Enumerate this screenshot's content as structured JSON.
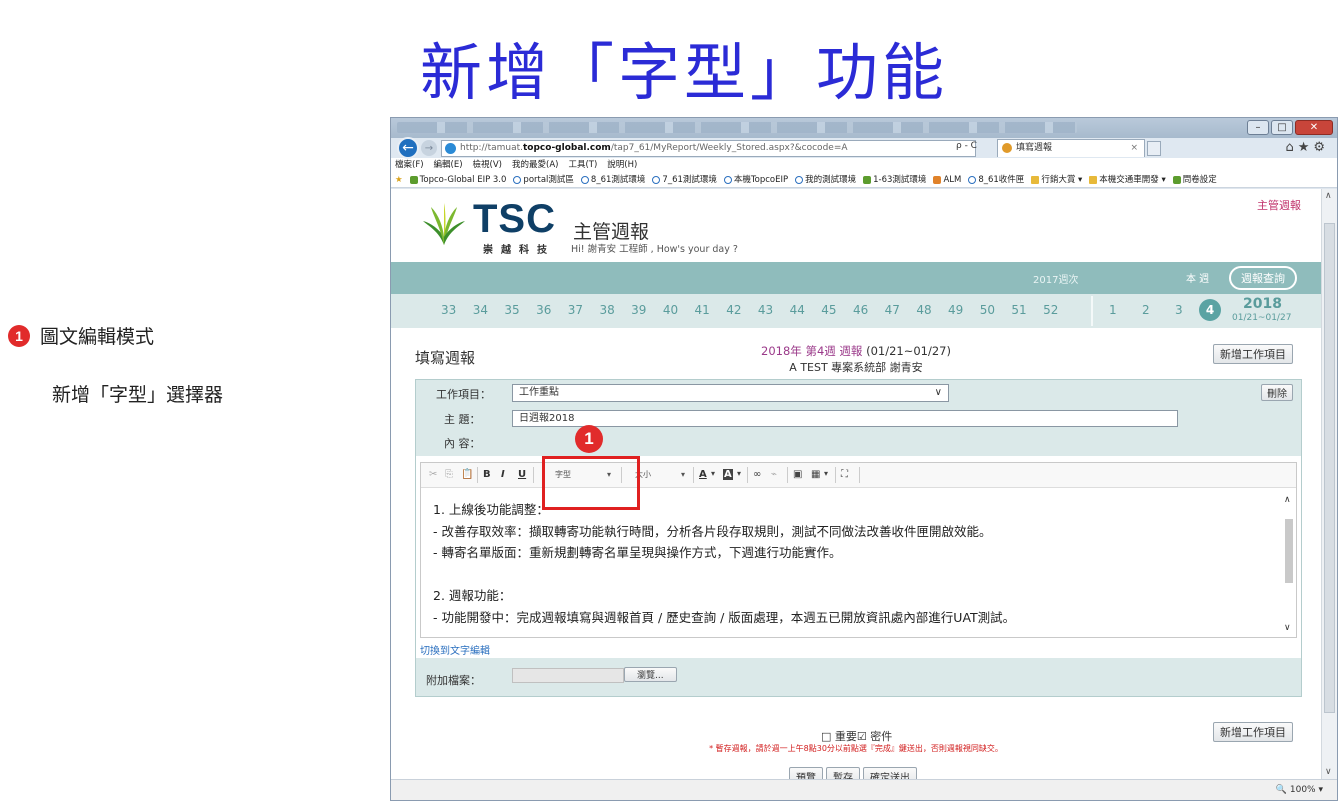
{
  "slide": {
    "title": "新增「字型」功能",
    "callout_number": "1",
    "callout_title": "圖文編輯模式",
    "callout_desc": "新增「字型」選擇器"
  },
  "browser": {
    "url_prefix": "http://tamuat.",
    "url_bold": "topco-global.com",
    "url_suffix": "/tap7_61/MyReport/Weekly_Stored.aspx?&cocode=A",
    "url_tools": "ρ - C",
    "tab_title": "填寫週報",
    "tab_close": "×",
    "menu": [
      "檔案(F)",
      "編輯(E)",
      "檢視(V)",
      "我的最愛(A)",
      "工具(T)",
      "說明(H)"
    ],
    "favorites": [
      {
        "label": "Topco-Global EIP 3.0",
        "icon": "leaf"
      },
      {
        "label": "portal測試區",
        "icon": "ie"
      },
      {
        "label": "8_61測試環境",
        "icon": "ie"
      },
      {
        "label": "7_61測試環境",
        "icon": "ie"
      },
      {
        "label": "本機TopcoEIP",
        "icon": "ie"
      },
      {
        "label": "我的測試環境",
        "icon": "ie"
      },
      {
        "label": "1-63測試環境",
        "icon": "leaf"
      },
      {
        "label": "ALM",
        "icon": "alm"
      },
      {
        "label": "8_61收件匣",
        "icon": "ie"
      },
      {
        "label": "行銷大賞 ▾",
        "icon": "folder"
      },
      {
        "label": "本機交通車開發 ▾",
        "icon": "folder"
      },
      {
        "label": "問卷設定",
        "icon": "leaf"
      }
    ],
    "zoom": "🔍 100%  ▾"
  },
  "app": {
    "logo_text": "TSC",
    "logo_sub": "崇越科技",
    "system_title": "主管週報",
    "greeting": "Hi! 謝青安 工程師 , How's your day ?",
    "top_link": "主管週報",
    "year_label": "2017週次",
    "current_week_label": "本 週",
    "query_button": "週報查詢",
    "weeks_2017": [
      "33",
      "34",
      "35",
      "36",
      "37",
      "38",
      "39",
      "40",
      "41",
      "42",
      "43",
      "44",
      "45",
      "46",
      "47",
      "48",
      "49",
      "50",
      "51",
      "52"
    ],
    "weeks_2018": [
      "1",
      "2",
      "3"
    ],
    "current_week": "4",
    "current_year": "2018",
    "current_range": "01/21~01/27"
  },
  "form": {
    "title": "填寫週報",
    "report_head": "2018年 第4週 週報",
    "report_range": " (01/21~01/27)",
    "report_author": "A TEST 專案系統部 謝青安",
    "add_item_button": "新增工作項目",
    "item_label": "工作項目：",
    "item_value": "工作重點",
    "delete_button": "刪除",
    "subject_label": "主 題：",
    "subject_value": "日週報2018",
    "content_label": "內 容：",
    "toolbar": {
      "cut": "✂",
      "copy": "⎘",
      "paste": "📋",
      "bold": "B",
      "italic": "I",
      "underline": "U",
      "font_combo": "字型",
      "size_combo": "大小",
      "text_color": "A",
      "bg_color": "A",
      "link": "∞",
      "unlink": "⌁",
      "image": "▣",
      "table": "▦",
      "maximize": "⛶"
    },
    "content_lines": [
      "1. 上線後功能調整：",
      " - 改善存取效率：擷取轉寄功能執行時間，分析各片段存取規則，測試不同做法改善收件匣開啟效能。",
      " - 轉寄名單版面：重新規劃轉寄名單呈現與操作方式，下週進行功能實作。",
      "",
      "2. 週報功能：",
      " - 功能開發中：完成週報填寫與週報首頁 / 歷史查詢 / 版面處理，本週五已開放資訊處內部進行UAT測試。"
    ],
    "switch_link": "切換到文字編輯",
    "attach_label": "附加檔案：",
    "browse_button": "瀏覽...",
    "important_label": "□ 重要",
    "confidential_label": "☑ 密件",
    "note": "* 暫存週報，請於週一上午8點30分以前點選『完成』鍵送出，否則週報視同缺交。",
    "buttons": [
      "預覽",
      "暫存",
      "確定送出"
    ]
  },
  "colors": {
    "title_blue": "#2b2bd6",
    "accent_red": "#e12b2b",
    "teal_band": "#8fbcbc",
    "teal_light": "#dbe9e9",
    "brand_navy": "#0f3f66"
  }
}
